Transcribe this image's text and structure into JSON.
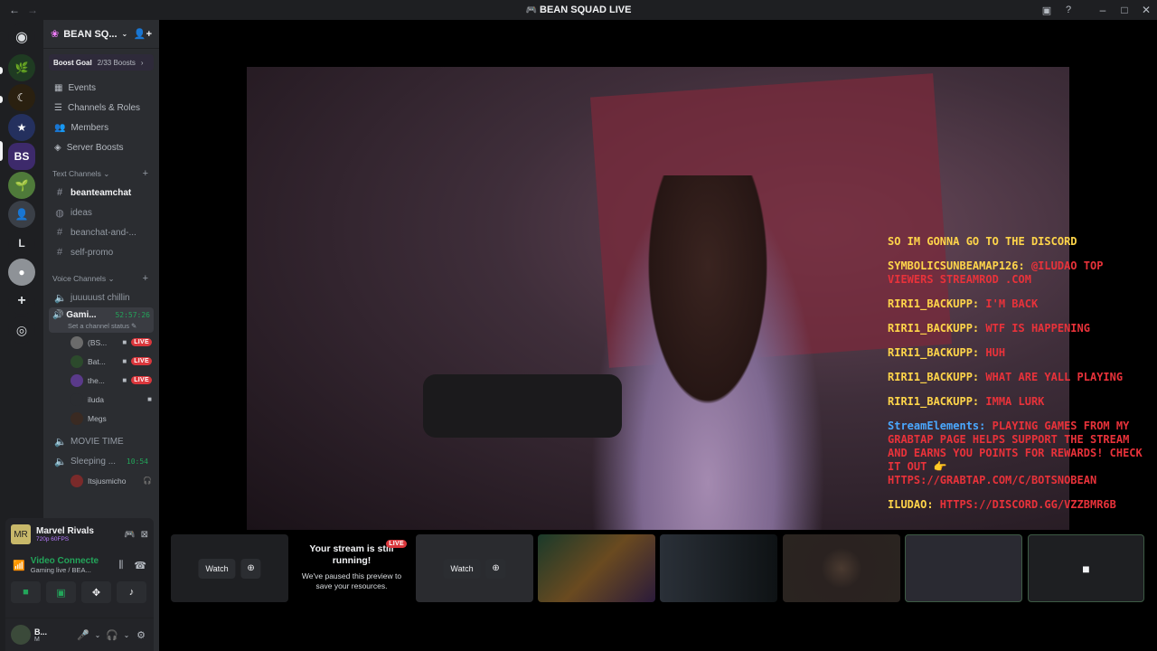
{
  "window": {
    "title": "BEAN SQUAD LIVE"
  },
  "guild": {
    "name": "BEAN SQ...",
    "boost": {
      "label": "Boost Goal",
      "count": "2/33 Boosts"
    },
    "menu": [
      "Events",
      "Channels & Roles",
      "Members",
      "Server Boosts"
    ],
    "text_category": "Text Channels",
    "text_channels": [
      "beanteamchat",
      "ideas",
      "beanchat-and-...",
      "self-promo"
    ],
    "voice_category": "Voice Channels",
    "voice_channels": {
      "first": "juuuuust chillin",
      "active": {
        "name": "Gami...",
        "timer": "52:57:26",
        "status": "Set a channel status"
      },
      "users": [
        {
          "name": "(BS...",
          "live": "LIVE"
        },
        {
          "name": "Bat...",
          "live": "LIVE"
        },
        {
          "name": "the...",
          "live": "LIVE"
        },
        {
          "name": "iluda"
        },
        {
          "name": "Megs"
        }
      ],
      "movie": "MOVIE TIME",
      "sleeping": {
        "name": "Sleeping ...",
        "timer": "10:54"
      },
      "sleeping_user": "Itsjusmicho"
    }
  },
  "activity": {
    "name": "Marvel Rivals",
    "sub": "720p 60FPS"
  },
  "voice_status": {
    "title": "Video Connecte",
    "sub": "Gaming live / BEA..."
  },
  "userpanel": {
    "name": "B...",
    "status": "M"
  },
  "overlay_chat": [
    {
      "user": "",
      "text": "SO IM GONNA GO TO THE DISCORD"
    },
    {
      "user": "SYMBOLICSUNBEAMAP126:",
      "text": "@ILUDAO TOP VIEWERS STREAMROD .COM"
    },
    {
      "user": "RIRI1_BACKUPP:",
      "text": "I'M BACK"
    },
    {
      "user": "RIRI1_BACKUPP:",
      "text": "WTF IS HAPPENING"
    },
    {
      "user": "RIRI1_BACKUPP:",
      "text": "HUH"
    },
    {
      "user": "RIRI1_BACKUPP:",
      "text": "WHAT ARE YALL PLAYING"
    },
    {
      "user": "RIRI1_BACKUPP:",
      "text": "IMMA LURK"
    },
    {
      "user": "StreamElements:",
      "text": "PLAYING GAMES FROM MY GRABTAP PAGE HELPS SUPPORT THE STREAM AND EARNS YOU POINTS FOR REWARDS! CHECK IT OUT 👉 HTTPS://GRABTAP.COM/C/BOTSNOBEAN"
    },
    {
      "user": "ILUDAO:",
      "text": "HTTPS://DISCORD.GG/VZZBMR6B"
    }
  ],
  "tiles": {
    "watch_label": "Watch",
    "paused_title": "Your stream is still running!",
    "paused_sub": "We've paused this preview to save your resources.",
    "live": "LIVE"
  },
  "colors": {
    "live": "#da373c",
    "accent_green": "#23a55a",
    "chat_user": "#ffd54a",
    "chat_text": "#e8323a"
  }
}
